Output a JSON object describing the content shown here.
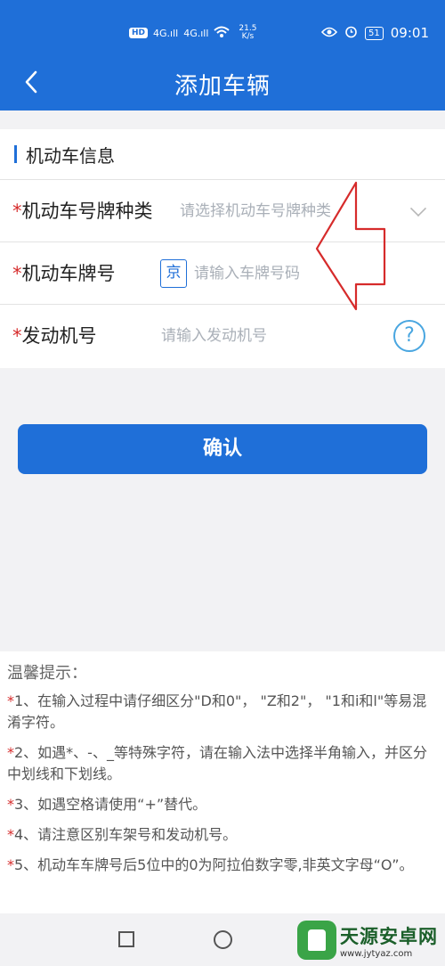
{
  "status_bar": {
    "hd": "HD",
    "signal1": "4G.ıll",
    "signal2": "4G.ıll",
    "net_speed_value": "21.5",
    "net_speed_unit": "K/s",
    "battery": "51",
    "time": "09:01"
  },
  "header": {
    "back_icon": "chevron-left-icon",
    "title": "添加车辆"
  },
  "section": {
    "title": "机动车信息"
  },
  "form": {
    "plate_type": {
      "required": "*",
      "label": "机动车号牌种类",
      "placeholder": "请选择机动车号牌种类"
    },
    "plate_number": {
      "required": "*",
      "label": "机动车牌号",
      "prefix": "京",
      "placeholder": "请输入车牌号码"
    },
    "engine_number": {
      "required": "*",
      "label": "发动机号",
      "placeholder": "请输入发动机号",
      "help": "?"
    }
  },
  "confirm_label": "确认",
  "tips": {
    "title": "温馨提示：",
    "items": [
      {
        "star": "*",
        "text": "1、在输入过程中请仔细区分\"D和0\"， \"Z和2\"， \"1和i和l\"等易混淆字符。"
      },
      {
        "star": "*",
        "text": "2、如遇*、-、_等特殊字符，请在输入法中选择半角输入，并区分中划线和下划线。"
      },
      {
        "star": "*",
        "text": "3、如遇空格请使用“+”替代。"
      },
      {
        "star": "*",
        "text": "4、请注意区别车架号和发动机号。"
      },
      {
        "star": "*",
        "text": "5、机动车车牌号后5位中的0为阿拉伯数字零,非英文字母“O”。"
      }
    ]
  },
  "watermark": {
    "name": "天源安卓网",
    "url": "www.jytyaz.com"
  },
  "colors": {
    "brand": "#1f6fd8",
    "required": "#d62b2b",
    "annotation_arrow": "#d62b2b"
  }
}
